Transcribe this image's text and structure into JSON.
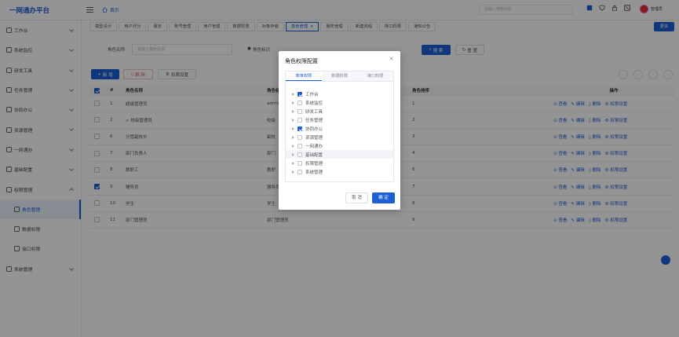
{
  "app": {
    "title": "一网通办平台",
    "home": "首页"
  },
  "header": {
    "search_placeholder": "请输入搜索内容",
    "user_name": "管理员"
  },
  "sidebar": {
    "items": [
      {
        "label": "工作台"
      },
      {
        "label": "系统监控"
      },
      {
        "label": "研发工具"
      },
      {
        "label": "任务管理"
      },
      {
        "label": "协同办公"
      },
      {
        "label": "资源管理"
      },
      {
        "label": "一网通办"
      },
      {
        "label": "基础配置"
      },
      {
        "label": "权限管理"
      },
      {
        "label": "角色管理"
      },
      {
        "label": "数据权限"
      },
      {
        "label": "接口权限"
      },
      {
        "label": "系统管理"
      }
    ]
  },
  "tabs": [
    "模型设计",
    "用户评分",
    "服务",
    "账号管理",
    "用户管理",
    "数据权限",
    "对象存储",
    "角色管理",
    "服务管理",
    "新建流程",
    "接口权限",
    "通知公告"
  ],
  "more_label": "更多",
  "filter": {
    "role_name_label": "角色名称",
    "role_name_placeholder": "请输入角色名称",
    "role_code_label": "角色标识",
    "search_label": "搜 索",
    "reset_label": "重 置"
  },
  "actions": {
    "add": "新 增",
    "delete": "删 除",
    "perm": "权限设置"
  },
  "table": {
    "headers": [
      "",
      "#",
      "角色名称",
      "角色标识",
      "角色排序",
      "操作"
    ],
    "rows": [
      {
        "checked": false,
        "no": "1",
        "name": "超级管理员",
        "code": "admin",
        "sort": "1"
      },
      {
        "checked": false,
        "no": "2",
        "name": "> 校级管理员",
        "code": "校级",
        "sort": "2"
      },
      {
        "checked": false,
        "no": "6",
        "name": "分管副校长",
        "code": "副校",
        "sort": "3"
      },
      {
        "checked": false,
        "no": "7",
        "name": "部门负责人",
        "code": "部门",
        "sort": "4"
      },
      {
        "checked": false,
        "no": "8",
        "name": "教职工",
        "code": "教职",
        "sort": "6"
      },
      {
        "checked": true,
        "no": "9",
        "name": "辅导员",
        "code": "辅导员",
        "sort": "7"
      },
      {
        "checked": false,
        "no": "10",
        "name": "学生",
        "code": "学生",
        "sort": "8"
      },
      {
        "checked": false,
        "no": "11",
        "name": "部门管理员",
        "code": "部门管理员",
        "sort": "9"
      }
    ],
    "ops": [
      "查看",
      "编辑",
      "删除",
      "权限设置"
    ]
  },
  "modal": {
    "title": "角色权限配置",
    "close": "×",
    "tabs": [
      "菜单权限",
      "数据权限",
      "接口权限"
    ],
    "tree": [
      {
        "label": "工作台",
        "checked": true
      },
      {
        "label": "系统监控",
        "checked": false
      },
      {
        "label": "研发工具",
        "checked": false
      },
      {
        "label": "任务管理",
        "checked": false
      },
      {
        "label": "协同办公",
        "checked": true
      },
      {
        "label": "资源管理",
        "checked": false
      },
      {
        "label": "一网通办",
        "checked": false
      },
      {
        "label": "基础配置",
        "checked": false
      },
      {
        "label": "权限管理",
        "checked": false
      },
      {
        "label": "系统管理",
        "checked": false
      }
    ],
    "cancel": "取 消",
    "ok": "确 定"
  },
  "colors": {
    "primary": "#1d5fd6",
    "danger": "#e34b4b",
    "overlay": "rgba(0,0,0,0.42)"
  }
}
